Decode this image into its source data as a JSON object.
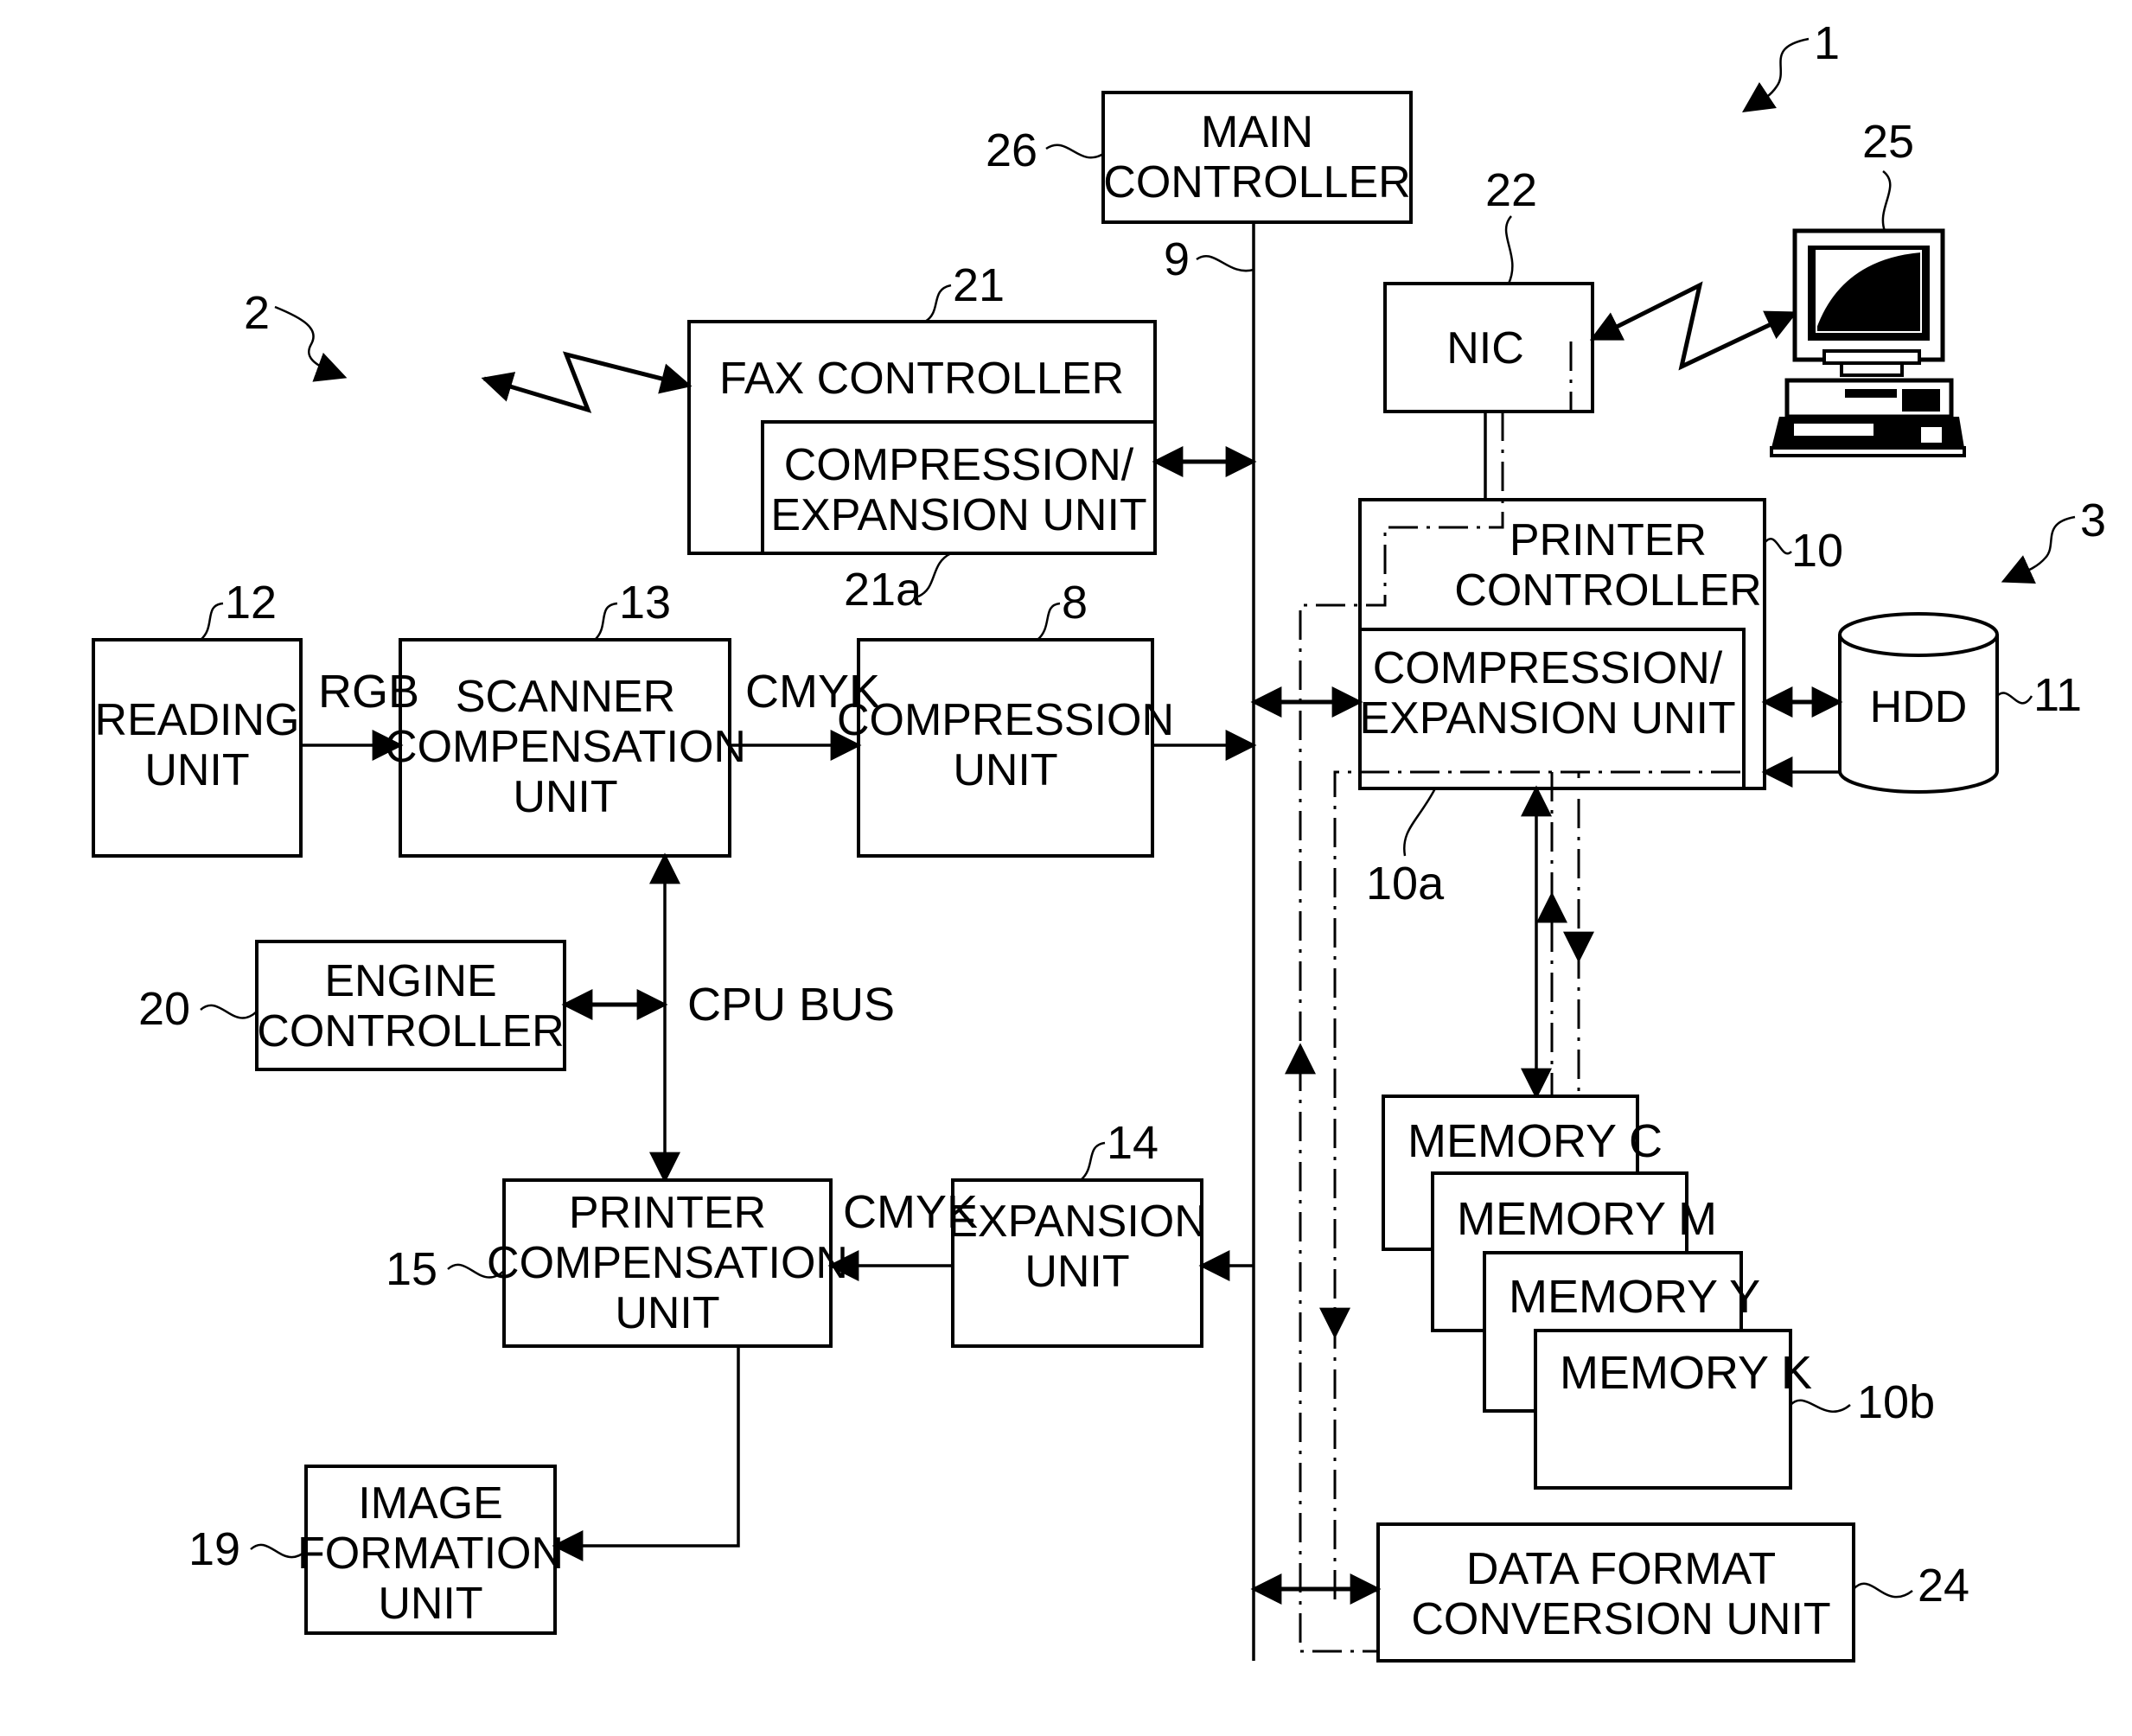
{
  "figure_refs": {
    "system": "1",
    "copier": "2",
    "printer_side": "3"
  },
  "blocks": {
    "main_controller": {
      "ref": "26",
      "lines": [
        "MAIN",
        "CONTROLLER"
      ]
    },
    "bus": {
      "ref": "9"
    },
    "fax_controller": {
      "ref": "21",
      "lines": [
        "FAX CONTROLLER"
      ]
    },
    "fax_comp_exp": {
      "ref": "21a",
      "lines": [
        "COMPRESSION/",
        "EXPANSION UNIT"
      ]
    },
    "nic": {
      "ref": "22",
      "lines": [
        "NIC"
      ]
    },
    "computer": {
      "ref": "25"
    },
    "printer_controller": {
      "ref": "10",
      "lines": [
        "PRINTER",
        "CONTROLLER"
      ]
    },
    "printer_comp_exp": {
      "ref": "10a",
      "lines": [
        "COMPRESSION/",
        "EXPANSION UNIT"
      ]
    },
    "hdd": {
      "ref": "11",
      "lines": [
        "HDD"
      ]
    },
    "reading_unit": {
      "ref": "12",
      "lines": [
        "READING",
        "UNIT"
      ]
    },
    "scanner_comp": {
      "ref": "13",
      "lines": [
        "SCANNER",
        "COMPENSATION",
        "UNIT"
      ]
    },
    "compression_unit": {
      "ref": "8",
      "lines": [
        "COMPRESSION",
        "UNIT"
      ]
    },
    "engine_controller": {
      "ref": "20",
      "lines": [
        "ENGINE",
        "CONTROLLER"
      ]
    },
    "printer_comp": {
      "ref": "15",
      "lines": [
        "PRINTER",
        "COMPENSATION",
        "UNIT"
      ]
    },
    "expansion_unit": {
      "ref": "14",
      "lines": [
        "EXPANSION",
        "UNIT"
      ]
    },
    "image_formation": {
      "ref": "19",
      "lines": [
        "IMAGE",
        "FORMATION",
        "UNIT"
      ]
    },
    "memory_c": {
      "lines": [
        "MEMORY C"
      ]
    },
    "memory_m": {
      "lines": [
        "MEMORY M"
      ]
    },
    "memory_y": {
      "lines": [
        "MEMORY Y"
      ]
    },
    "memory_k": {
      "lines": [
        "MEMORY K"
      ]
    },
    "memories": {
      "ref": "10b"
    },
    "data_format": {
      "ref": "24",
      "lines": [
        "DATA FORMAT",
        "CONVERSION UNIT"
      ]
    }
  },
  "signal_labels": {
    "rgb": "RGB",
    "cmyk_scan": "CMYK",
    "cmyk_print": "CMYK",
    "cpu_bus": "CPU BUS"
  }
}
